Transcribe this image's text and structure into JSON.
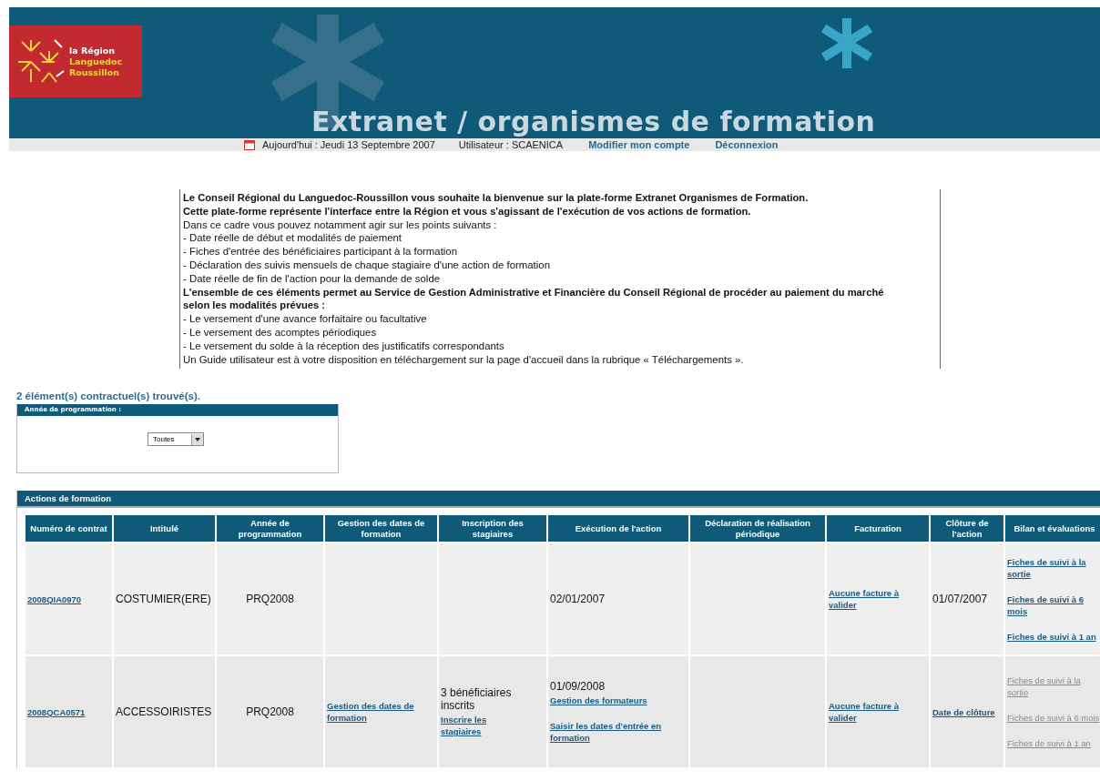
{
  "header": {
    "logo_lines": [
      "la Région",
      "Languedoc",
      "Roussillon"
    ],
    "title": "Extranet / organismes de formation"
  },
  "info_bar": {
    "date": "Aujourd'hui : Jeudi 13 Septembre 2007",
    "user": "Utilisateur : SCAENICA",
    "links": [
      "Modifier mon compte",
      "Déconnexion"
    ]
  },
  "intro": [
    {
      "text": "Le Conseil Régional du Languedoc-Roussillon vous souhaite la bienvenue sur la plate-forme Extranet Organismes de Formation.",
      "bold": true
    },
    {
      "text": "Cette plate-forme représente l'interface entre la Région et vous s'agissant de l'exécution de vos actions de formation.",
      "bold": true
    },
    {
      "text": "Dans ce cadre vous pouvez notamment agir sur les points suivants :",
      "bold": false
    },
    {
      "text": "- Date réelle de début et modalités de paiement",
      "bold": false
    },
    {
      "text": "- Fiches d'entrée des bénéficiaires participant à la formation",
      "bold": false
    },
    {
      "text": "- Déclaration des suivis mensuels de chaque stagiaire d'une action de formation",
      "bold": false
    },
    {
      "text": "- Date réelle de fin de l'action pour la demande de solde",
      "bold": false
    },
    {
      "text": "L'ensemble de ces éléments permet au Service de Gestion Administrative et Financière du Conseil Régional de procéder au paiement du marché selon les modalités prévues :",
      "bold": true
    },
    {
      "text": "- Le versement d'une avance forfaitaire ou facultative",
      "bold": false
    },
    {
      "text": "- Le versement des acomptes périodiques",
      "bold": false
    },
    {
      "text": "- Le versement du solde à la réception des justificatifs correspondants",
      "bold": false
    },
    {
      "text": "Un Guide utilisateur est à votre disposition en téléchargement sur la page d'accueil dans la rubrique « Téléchargements ».",
      "bold": false
    }
  ],
  "result_count": "2 élément(s) contractuel(s) trouvé(s).",
  "filter": {
    "title": "Année de programmation :",
    "select_value": "Toutes"
  },
  "table": {
    "title": "Actions de formation",
    "columns": [
      "Numéro de contrat",
      "Intitulé",
      "Année de programmation",
      "Gestion des dates de formation",
      "Inscription des stagiaires",
      "Exécution de l'action",
      "Déclaration de réalisation périodique",
      "Facturation",
      "Clôture de l'action",
      "Bilan et évaluations"
    ],
    "rows": [
      [
        [
          {
            "kind": "link",
            "text": "2008QIA0970",
            "disabled": false
          }
        ],
        [
          {
            "kind": "text",
            "text": "COSTUMIER(ERE)"
          }
        ],
        [
          {
            "kind": "text",
            "text": "PRQ2008"
          }
        ],
        [],
        [],
        [
          {
            "kind": "text",
            "text": "02/01/2007"
          }
        ],
        [],
        [
          {
            "kind": "link",
            "text": "Aucune facture à valider",
            "disabled": false
          }
        ],
        [
          {
            "kind": "text",
            "text": "01/07/2007"
          }
        ],
        [
          {
            "kind": "link",
            "text": "Fiches de suivi à la sortie",
            "disabled": false
          },
          {
            "kind": "link",
            "text": "Fiches de suivi à 6 mois",
            "disabled": false
          },
          {
            "kind": "link",
            "text": "Fiches de suivi à 1 an",
            "disabled": false
          }
        ]
      ],
      [
        [
          {
            "kind": "link",
            "text": "2008QCA0571",
            "disabled": false
          }
        ],
        [
          {
            "kind": "text",
            "text": "ACCESSOIRISTES"
          }
        ],
        [
          {
            "kind": "text",
            "text": "PRQ2008"
          }
        ],
        [
          {
            "kind": "link",
            "text": "Gestion des dates de formation",
            "disabled": false
          }
        ],
        [
          {
            "kind": "text",
            "text": "3 bénéficiaires inscrits"
          },
          {
            "kind": "link",
            "text": "Inscrire les stagiaires",
            "disabled": false
          }
        ],
        [
          {
            "kind": "text",
            "text": "01/09/2008"
          },
          {
            "kind": "link",
            "text": "Gestion des formateurs",
            "disabled": false
          },
          {
            "kind": "link",
            "text": "Saisir les dates d'entrée en formation",
            "disabled": false
          }
        ],
        [],
        [
          {
            "kind": "link",
            "text": "Aucune facture à valider",
            "disabled": false
          }
        ],
        [
          {
            "kind": "link",
            "text": "Date de clôture",
            "disabled": false
          }
        ],
        [
          {
            "kind": "link",
            "text": "Fiches de suivi à la sortie",
            "disabled": true
          },
          {
            "kind": "link",
            "text": "Fiches de suivi à 6 mois",
            "disabled": true
          },
          {
            "kind": "link",
            "text": "Fiches de suivi à 1 an",
            "disabled": true
          }
        ]
      ]
    ]
  }
}
